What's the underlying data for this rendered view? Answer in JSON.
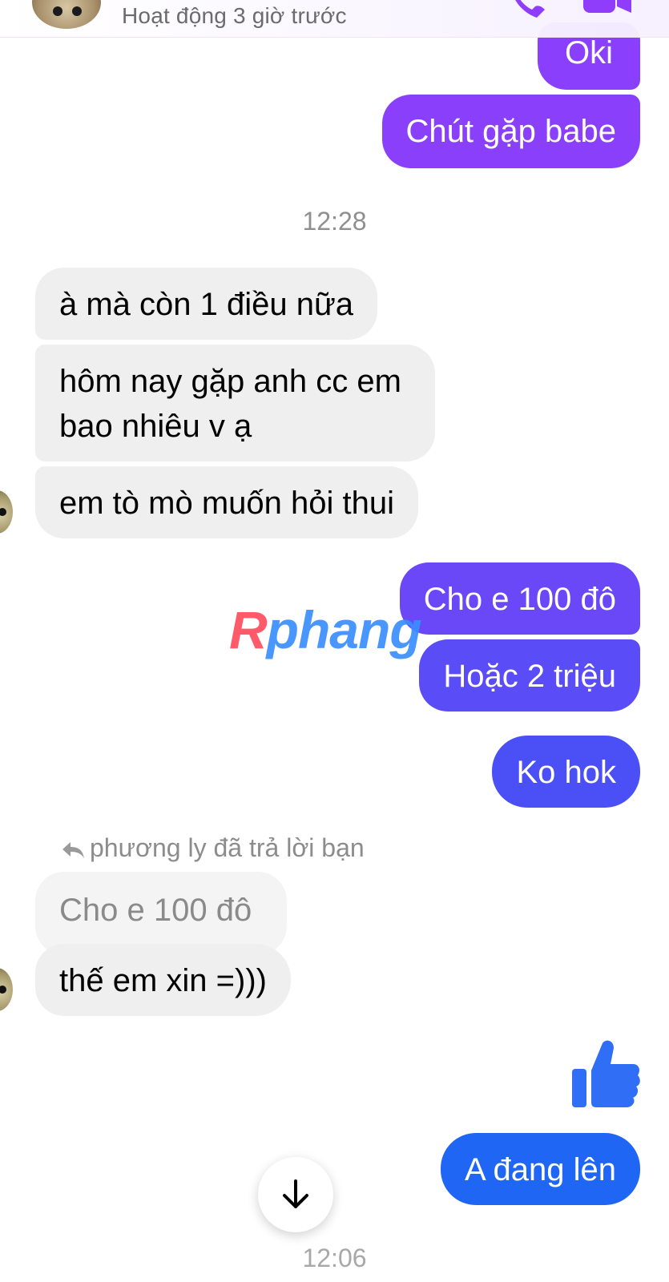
{
  "header": {
    "status": "Hoạt động 3 giờ trước",
    "call_icon": "phone-icon",
    "video_icon": "video-camera-icon",
    "accent": "#8f3dfa"
  },
  "messages": {
    "m1": "Oki",
    "m2": "Chút gặp babe",
    "time1": "12:28",
    "m3": "à mà còn 1 điều nữa",
    "m4_line1": "hôm nay gặp anh cc em",
    "m4_line2": "bao nhiêu v ạ",
    "m5": "em tò mò muốn hỏi thui",
    "m6": "Cho e 100 đô",
    "m7": "Hoặc 2 triệu",
    "m8": "Ko hok",
    "reply_label": "phương ly đã trả lời bạn",
    "reply_quote": "Cho e 100 đô",
    "m9": "thế em xin =)))",
    "like_icon": "thumbs-up-icon",
    "m10": "A đang lên",
    "time2": "12:06"
  },
  "watermark": {
    "part1": "R",
    "part2": "phang"
  },
  "colors": {
    "purple": "#8a3ffc",
    "violet": "#6b45f6",
    "blue": "#4150f5",
    "bubble_in": "#efefef",
    "like": "#2f6ef5"
  }
}
